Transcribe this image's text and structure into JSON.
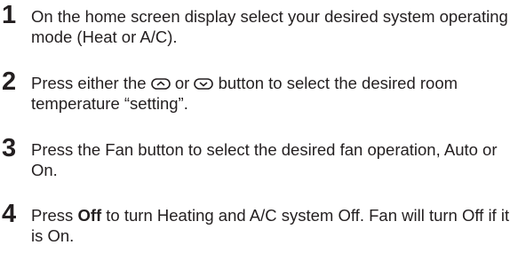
{
  "steps": [
    {
      "number": "1",
      "text": "On the home screen display select your desired system operating mode (Heat or A/C)."
    },
    {
      "number": "2",
      "text_before": "Press either the",
      "text_middle": "or",
      "text_after": "button to select the desired room temperature “setting”.",
      "icons": [
        "up-arrow-button-icon",
        "down-arrow-button-icon"
      ]
    },
    {
      "number": "3",
      "text": "Press the Fan button to select the desired fan operation, Auto or On."
    },
    {
      "number": "4",
      "text_before": "Press",
      "bold_word": "Off",
      "text_after": "to turn Heating and A/C system Off. Fan will turn Off if it is On."
    }
  ],
  "colors": {
    "text": "#231f20"
  }
}
